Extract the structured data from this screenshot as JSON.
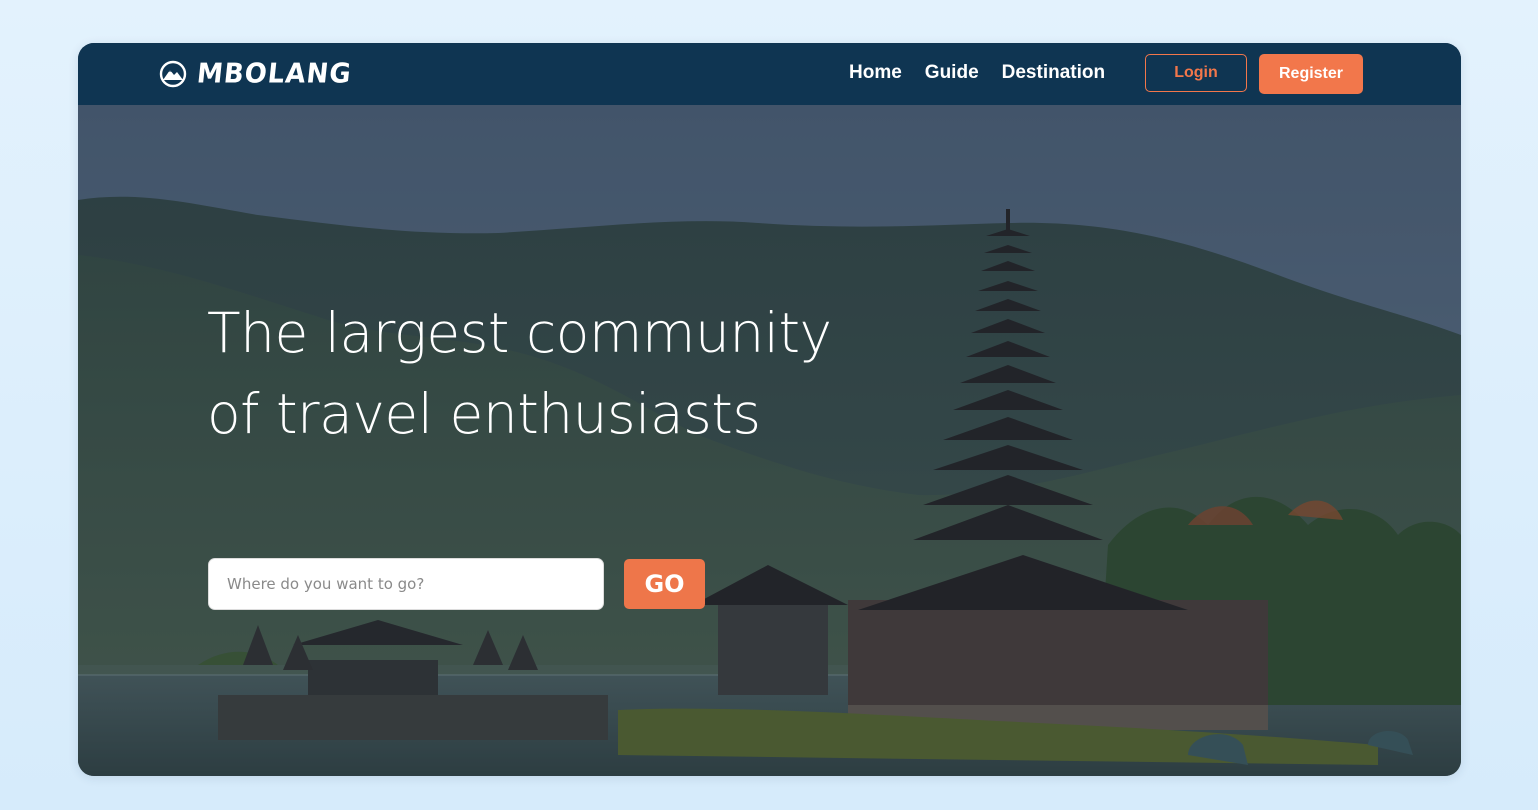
{
  "brand": {
    "name": "MBOLANG",
    "icon": "mountain-circle-icon"
  },
  "nav": {
    "links": [
      {
        "label": "Home"
      },
      {
        "label": "Guide"
      },
      {
        "label": "Destination"
      }
    ],
    "login_label": "Login",
    "register_label": "Register"
  },
  "hero": {
    "headline_line1": "The largest community",
    "headline_line2": "of travel enthusiasts",
    "search_placeholder": "Where do you want to go?",
    "go_label": "GO",
    "background": "temple-lake-mountains-image"
  },
  "colors": {
    "page_background": "#dcedfb",
    "navbar": "#0f3552",
    "accent": "#f2774b",
    "text_on_dark": "#ffffff"
  }
}
